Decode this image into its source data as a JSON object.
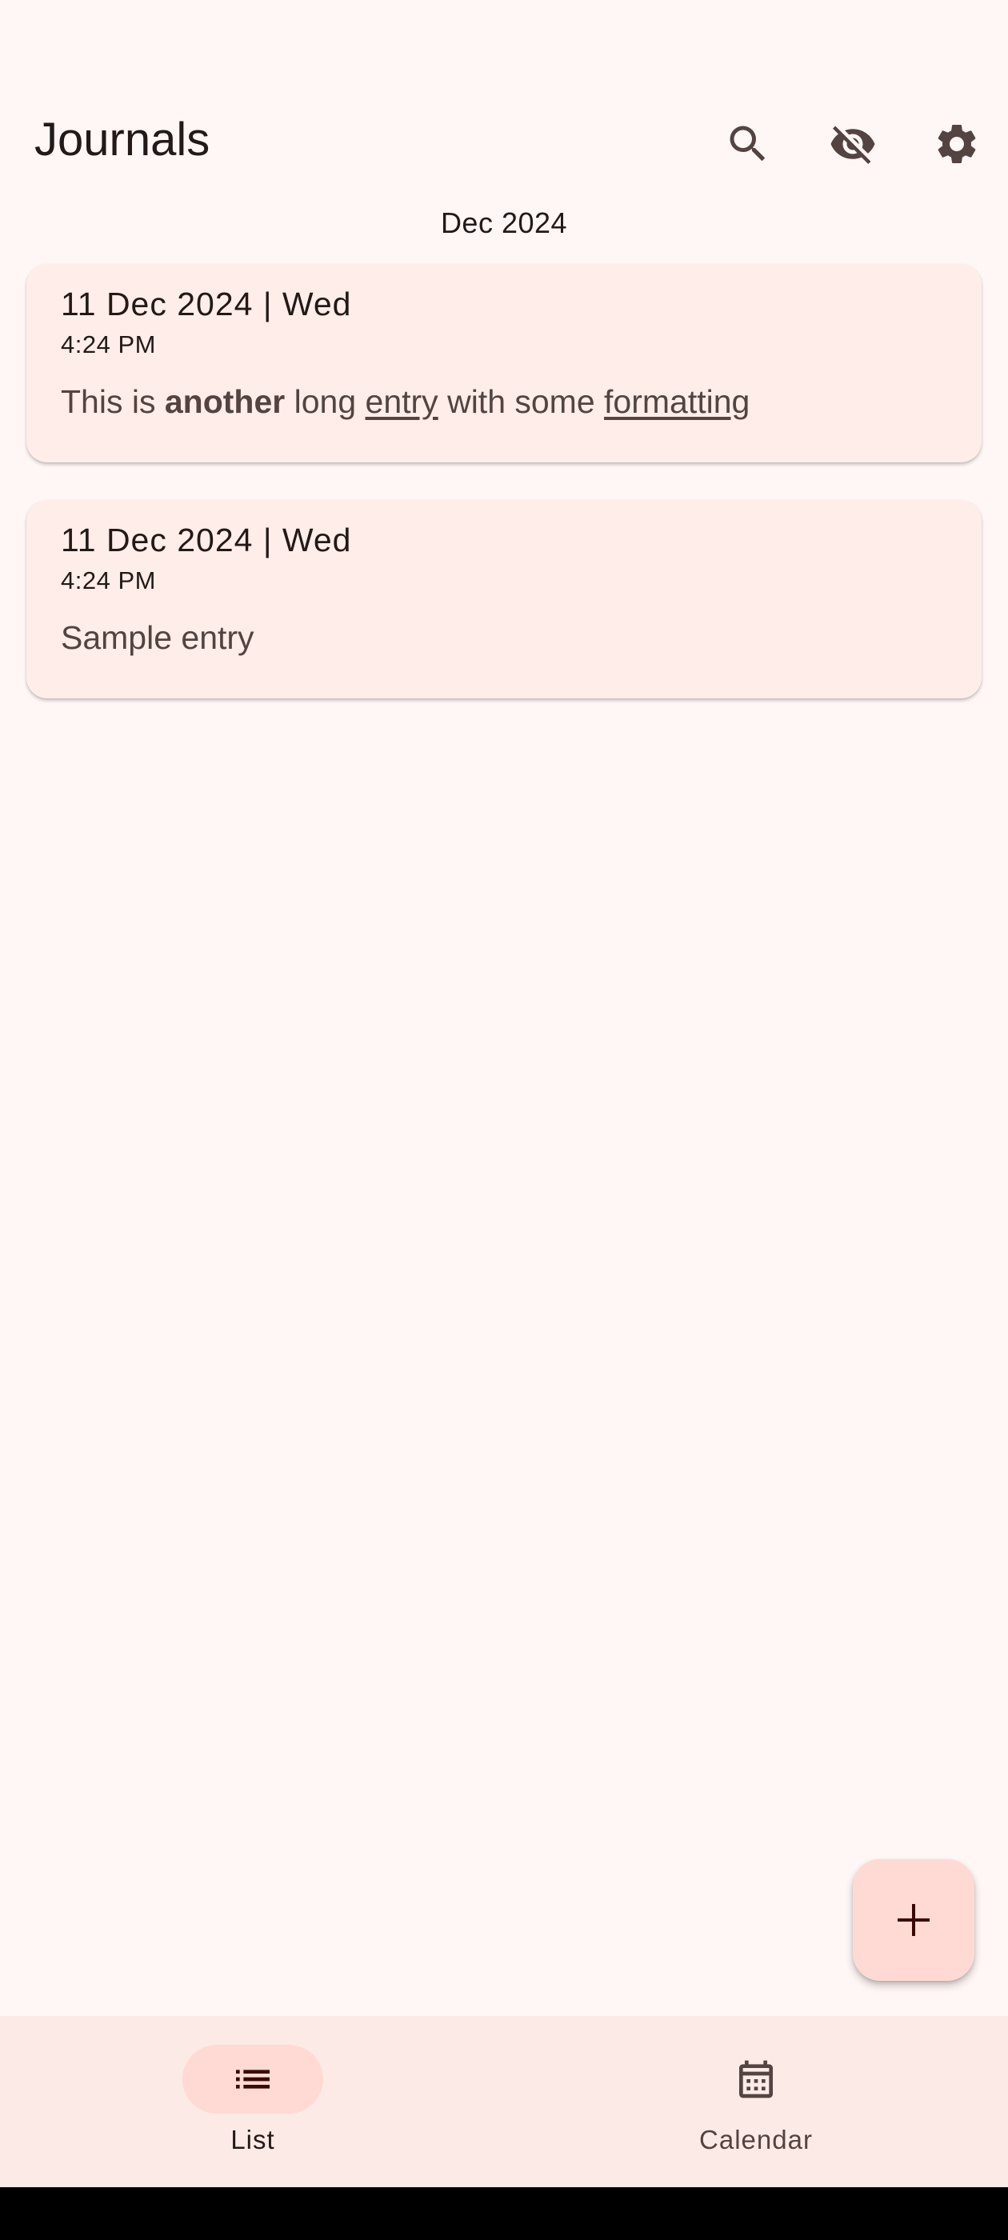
{
  "app_bar": {
    "title": "Journals",
    "actions": [
      {
        "icon": "search-icon",
        "label": "Search"
      },
      {
        "icon": "visibility-off-icon",
        "label": "Hide entries"
      },
      {
        "icon": "settings-icon",
        "label": "Settings"
      }
    ]
  },
  "month_header": "Dec 2024",
  "entries": [
    {
      "date": "11 Dec 2024 | Wed",
      "time": "4:24 PM",
      "body_parts": [
        "This is ",
        "another",
        " long ",
        "entry",
        " with some ",
        "formatting"
      ]
    },
    {
      "date": "11 Dec 2024 | Wed",
      "time": "4:24 PM",
      "body": "Sample entry"
    }
  ],
  "fab": {
    "icon": "add-icon"
  },
  "bottom_nav": {
    "items": [
      {
        "label": "List",
        "icon": "list-icon",
        "selected": true
      },
      {
        "label": "Calendar",
        "icon": "calendar-icon",
        "selected": false
      }
    ]
  },
  "colors": {
    "background": "#FFF7F5",
    "card": "#FFEDE9",
    "fab": "#FFDAD4",
    "nav_bar": "#FBEAE6",
    "nav_indicator": "#FFDAD4",
    "icon": "#534341",
    "text": "#231917"
  }
}
